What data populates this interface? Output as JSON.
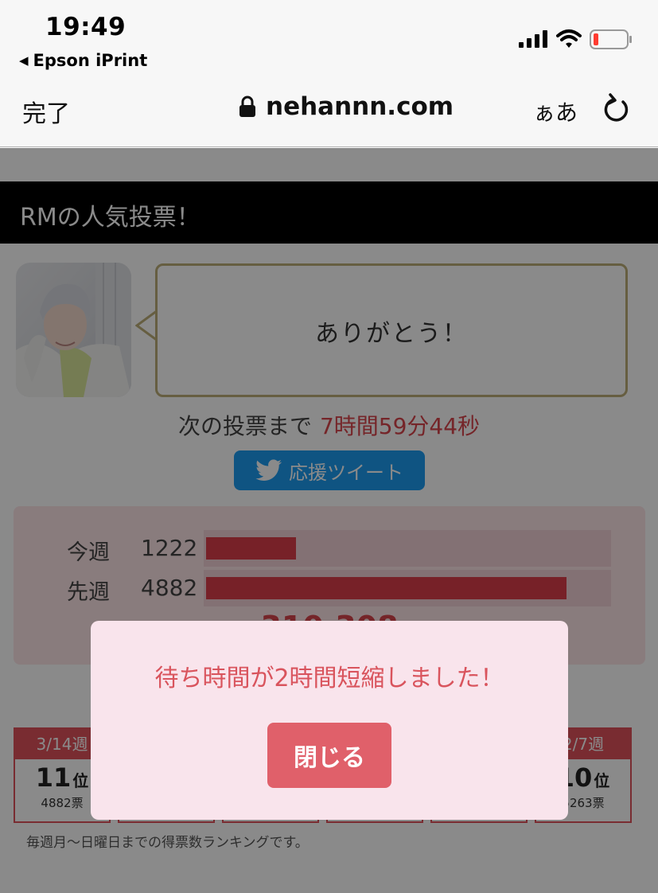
{
  "status_bar": {
    "time": "19:49",
    "back_app": "Epson iPrint"
  },
  "browser": {
    "done_label": "完了",
    "url": "nehannn.com",
    "text_size_label": "ぁあ"
  },
  "page": {
    "title": "RMの人気投票！",
    "bubble_text": "ありがとう！",
    "next_vote_label": "次の投票まで",
    "countdown": "7時間59分44秒",
    "tweet_button_label": "応援ツイート",
    "votes": [
      {
        "label": "今週",
        "count": "1222",
        "value": 1222
      },
      {
        "label": "先週",
        "count": "4882",
        "value": 4882
      }
    ],
    "total_votes": "310,308",
    "weeks": [
      {
        "week": "3/14週",
        "rank": "11",
        "rank_unit": "位",
        "votes": "4882票"
      },
      {
        "week": "",
        "rank": "",
        "rank_unit": "",
        "votes": ""
      },
      {
        "week": "",
        "rank": "",
        "rank_unit": "",
        "votes": ""
      },
      {
        "week": "",
        "rank": "",
        "rank_unit": "",
        "votes": ""
      },
      {
        "week": "",
        "rank": "",
        "rank_unit": "",
        "votes": ""
      },
      {
        "week": "2/7週",
        "rank": "10",
        "rank_unit": "位",
        "votes": "5263票"
      }
    ],
    "ranking_note": "毎週月〜日曜日までの得票数ランキングです。"
  },
  "modal": {
    "message": "待ち時間が2時間短縮しました！",
    "close_label": "閉じる"
  },
  "colors": {
    "accent_red": "#e0525b",
    "twitter_blue": "#1d9bf0",
    "bubble_border": "#bcae78"
  }
}
